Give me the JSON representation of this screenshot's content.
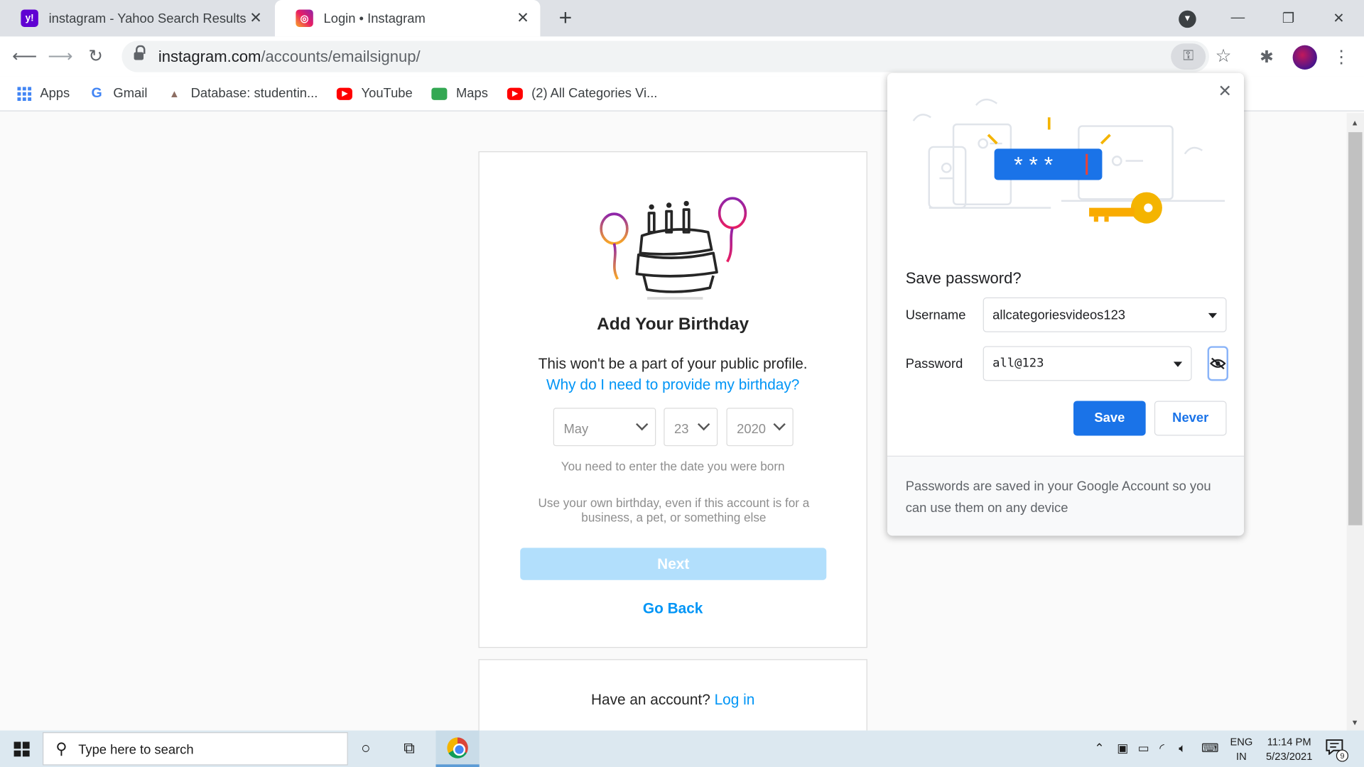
{
  "browser": {
    "tabs": [
      {
        "title": "instagram - Yahoo Search Results",
        "favicon": "yahoo-favicon",
        "active": false
      },
      {
        "title": "Login • Instagram",
        "favicon": "instagram-favicon",
        "active": true
      }
    ],
    "new_tab_symbol": "+",
    "url_domain": "instagram.com",
    "url_path": "/accounts/emailsignup/",
    "bookmarks": [
      {
        "label": "Apps",
        "icon": "apps-grid-icon"
      },
      {
        "label": "Gmail",
        "icon": "google-icon"
      },
      {
        "label": "Database: studentin...",
        "icon": "database-icon"
      },
      {
        "label": "YouTube",
        "icon": "youtube-icon"
      },
      {
        "label": "Maps",
        "icon": "maps-icon"
      },
      {
        "label": "(2) All Categories Vi...",
        "icon": "youtube-icon"
      }
    ]
  },
  "signup": {
    "title": "Add Your Birthday",
    "subtitle": "This won't be a part of your public profile.",
    "why_link": "Why do I need to provide my birthday?",
    "month": "May",
    "day": "23",
    "year": "2020",
    "hint": "You need to enter the date you were born",
    "hint2": "Use your own birthday, even if this account is for a business, a pet, or something else",
    "next_label": "Next",
    "back_label": "Go Back",
    "have_account": "Have an account?",
    "login_label": "Log in"
  },
  "save_password": {
    "title": "Save password?",
    "username_label": "Username",
    "username_value": "allcategoriesvideos123",
    "password_label": "Password",
    "password_value": "all@123",
    "illustration_mask": "* * *",
    "save_label": "Save",
    "never_label": "Never",
    "footer_text": "Passwords are saved in your Google Account so you can use them on any device",
    "accent_color": "#1a73e8"
  },
  "taskbar": {
    "search_placeholder": "Type here to search",
    "lang_top": "ENG",
    "lang_bottom": "IN",
    "time": "11:14 PM",
    "date": "5/23/2021",
    "notification_count": "9"
  },
  "colors": {
    "instagram_blue": "#0095f6",
    "next_disabled": "#b2dffc"
  }
}
